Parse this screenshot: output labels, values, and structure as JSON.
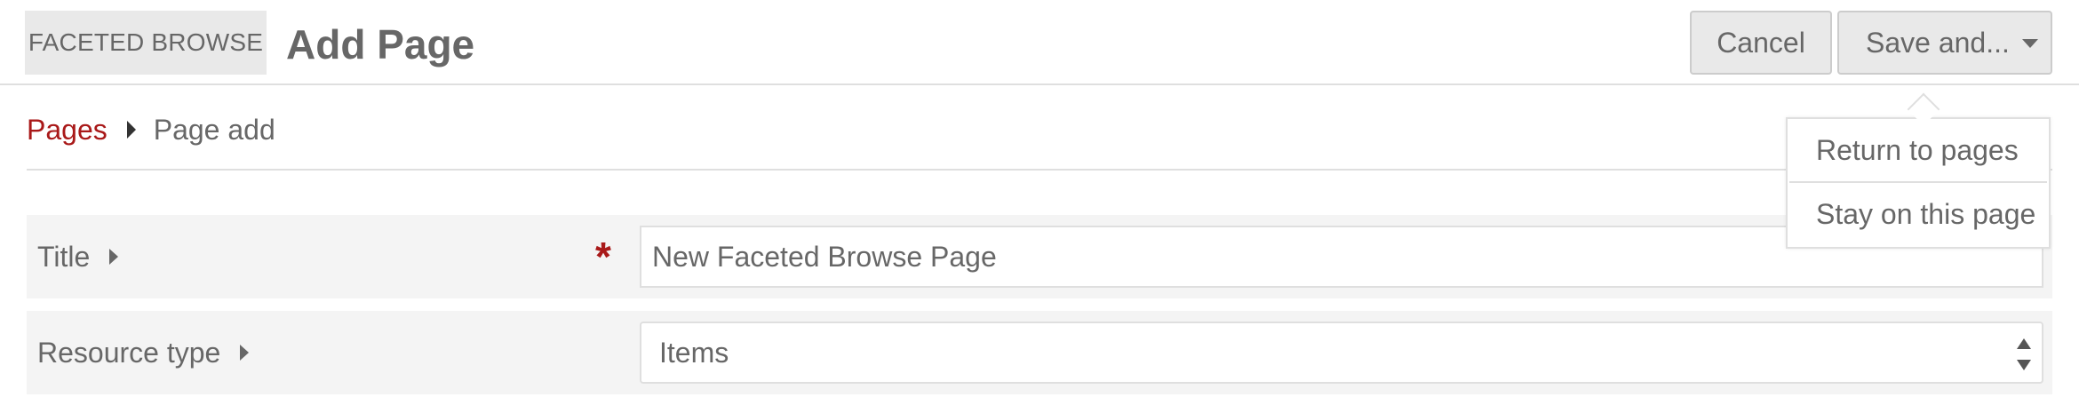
{
  "header": {
    "module_badge": "FACETED BROWSE",
    "title": "Add Page",
    "cancel_label": "Cancel",
    "save_label": "Save and..."
  },
  "breadcrumb": {
    "parent": "Pages",
    "current": "Page add"
  },
  "form": {
    "title_field": {
      "label": "Title",
      "required_mark": "*",
      "value": "New Faceted Browse Page"
    },
    "resource_type_field": {
      "label": "Resource type",
      "selected": "Items"
    }
  },
  "save_menu": {
    "items": [
      {
        "label": "Return to pages"
      },
      {
        "label": "Stay on this page"
      }
    ]
  },
  "colors": {
    "accent_red": "#a91919",
    "text_gray": "#676767",
    "row_background": "#f4f4f4",
    "button_background": "#e9e9e9"
  }
}
